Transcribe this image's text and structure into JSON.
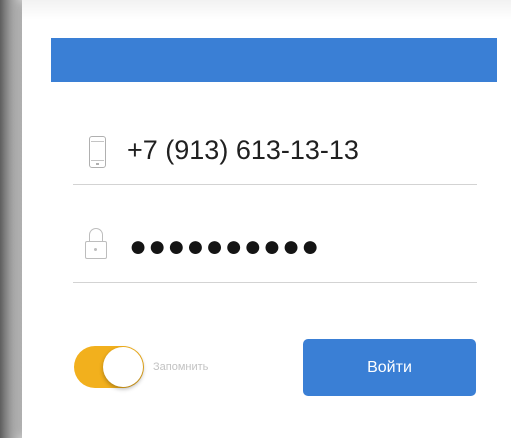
{
  "login_form": {
    "phone": {
      "value": "+7 (913) 613-13-13",
      "icon": "phone-icon"
    },
    "password": {
      "masked_value": "●●●●●●●●●●",
      "icon": "lock-icon"
    },
    "remember": {
      "label": "Запомнить",
      "enabled": true
    },
    "submit_label": "Войти"
  },
  "colors": {
    "accent": "#3a7fd5",
    "toggle_on": "#f2b01d",
    "page_background": "#ffffff"
  }
}
